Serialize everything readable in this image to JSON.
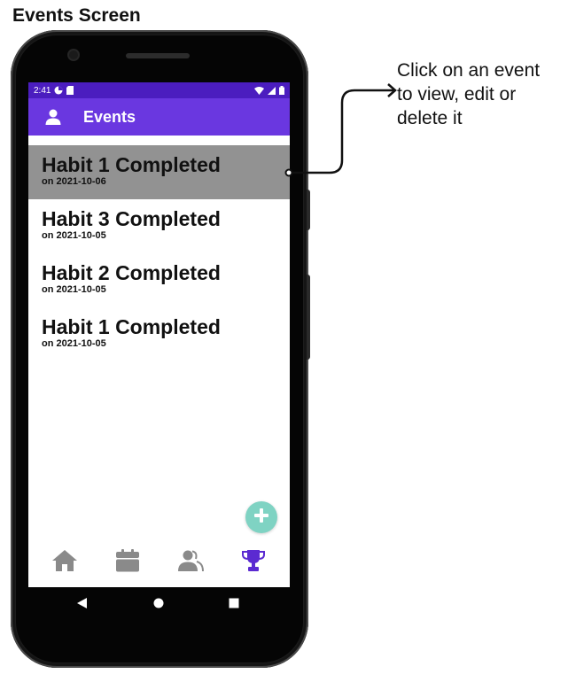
{
  "figure": {
    "title": "Events Screen",
    "callout_lines": [
      "Click on an event",
      "to view, edit or",
      "delete it"
    ]
  },
  "status_bar": {
    "time": "2:41",
    "icons": [
      "pie-chart-icon",
      "sd-card-icon",
      "wifi-icon",
      "signal-icon",
      "battery-icon"
    ]
  },
  "app_bar": {
    "title": "Events",
    "icon": "person-icon",
    "background": "#6a37e0",
    "status_background": "#4b1dbf"
  },
  "events": [
    {
      "title": "Habit 1 Completed",
      "date": "on 2021-10-06",
      "selected": true
    },
    {
      "title": "Habit 3 Completed",
      "date": "on 2021-10-05",
      "selected": false
    },
    {
      "title": "Habit 2 Completed",
      "date": "on 2021-10-05",
      "selected": false
    },
    {
      "title": "Habit 1 Completed",
      "date": "on 2021-10-05",
      "selected": false
    }
  ],
  "fab": {
    "icon": "plus-icon",
    "color": "#7fd3c3"
  },
  "bottom_nav": [
    {
      "name": "home",
      "icon": "home-icon",
      "active": false
    },
    {
      "name": "calendar",
      "icon": "calendar-icon",
      "active": false
    },
    {
      "name": "friends",
      "icon": "people-icon",
      "active": false
    },
    {
      "name": "events",
      "icon": "trophy-icon",
      "active": true
    }
  ],
  "colors": {
    "nav_inactive": "#8a8a8a",
    "nav_active": "#5b2ad1",
    "selected_row": "#929292"
  },
  "system_nav": [
    "back-icon",
    "home-circle-icon",
    "recents-icon"
  ]
}
